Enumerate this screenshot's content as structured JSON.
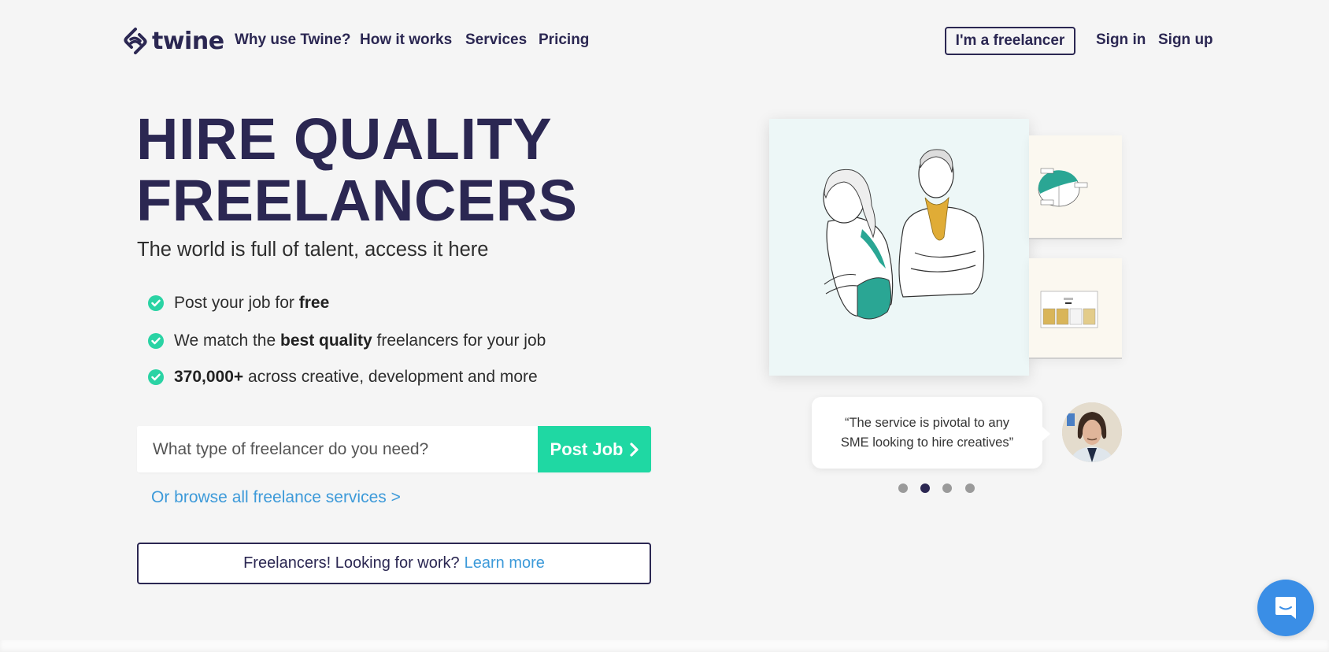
{
  "brand": {
    "name": "twine"
  },
  "nav": {
    "links": [
      {
        "label": "Why use Twine?"
      },
      {
        "label": "How it works"
      },
      {
        "label": "Services"
      },
      {
        "label": "Pricing"
      }
    ],
    "freelancer_button": "I'm a freelancer",
    "sign_in": "Sign in",
    "sign_up": "Sign up"
  },
  "hero": {
    "title_line1": "HIRE QUALITY",
    "title_line2": "FREELANCERS",
    "subtitle": "The world is full of talent, access it here",
    "bullets": [
      {
        "pre": "Post your job for ",
        "bold": "free",
        "post": ""
      },
      {
        "pre": "We match the ",
        "bold": "best quality",
        "post": " freelancers for your job"
      },
      {
        "pre": "",
        "bold": "370,000+",
        "post": " across creative, development and more"
      }
    ],
    "search": {
      "placeholder": "What type of freelancer do you need?",
      "value": ""
    },
    "post_job_button": "Post Job",
    "browse_link": "Or browse all freelance services >",
    "freelancer_prompt": "Freelancers! Looking for work?",
    "learn_more": "Learn more"
  },
  "showcase": {
    "illustration": "illustration of two people (woman and man with scarf)",
    "side_cards": [
      "pie chart thumbnail",
      "illustration grid thumbnail"
    ],
    "testimonial": {
      "line1": "“The service is pivotal to any",
      "line2": "SME looking to hire creatives”"
    },
    "carousel": {
      "total": 4,
      "active_index": 2
    }
  },
  "colors": {
    "primary": "#2b2752",
    "accent": "#1fd8a3",
    "link": "#3d9ad9",
    "chat": "#3a8ee6",
    "background": "#f5f5f5"
  },
  "icons": {
    "logo": "twine-logo-icon",
    "check": "check-circle-icon",
    "chevron": "chevron-right-icon",
    "chat": "chat-bubble-icon"
  }
}
